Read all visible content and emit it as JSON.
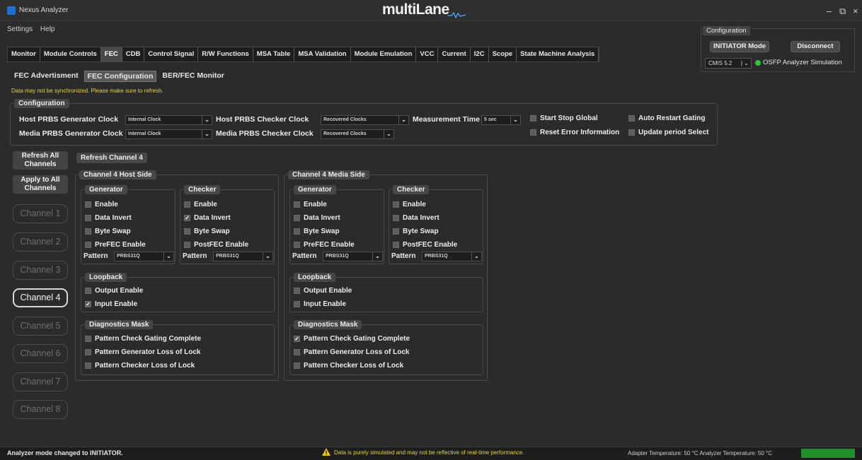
{
  "window": {
    "app_title": "Nexus Analyzer",
    "logo_text": "multiLane",
    "controls": [
      "–",
      "⧉",
      "×"
    ]
  },
  "menu": [
    "Settings",
    "Help"
  ],
  "main_tabs": [
    "Monitor",
    "Module Controls",
    "FEC",
    "CDB",
    "Control Signal",
    "R/W Functions",
    "MSA Table",
    "MSA Validation",
    "Module Emulation",
    "VCC",
    "Current",
    "I2C",
    "Scope",
    "State Machine Analysis"
  ],
  "main_tab_active": "FEC",
  "top_config": {
    "label": "Configuration",
    "mode_button": "INITIATOR Mode",
    "disconnect_button": "Disconnect",
    "cmis_value": "CMIS 5.2",
    "sim_label": "OSFP Analyzer Simulation",
    "led_color": "#27c93f"
  },
  "sub_tabs": [
    "FEC Advertisment",
    "FEC Configuration",
    "BER/FEC Monitor"
  ],
  "sub_tab_active": "FEC Configuration",
  "warning": "Data may not be synchronized. Please make sure to refresh.",
  "configuration": {
    "label": "Configuration",
    "host_gen_label": "Host PRBS Generator Clock",
    "host_gen_value": "Internal Clock",
    "media_gen_label": "Media PRBS Generator Clock",
    "media_gen_value": "Internal Clock",
    "host_chk_label": "Host PRBS Checker Clock",
    "host_chk_value": "Recovered Clocks",
    "media_chk_label": "Media PRBS Checker Clock",
    "media_chk_value": "Recovered Clocks",
    "meas_label": "Measurement Time",
    "meas_value": "5 sec",
    "start_stop": "Start Stop Global",
    "reset_error": "Reset Error Information",
    "auto_restart": "Auto Restart Gating",
    "update_period": "Update period Select"
  },
  "sidebar": {
    "refresh_all": "Refresh All Channels",
    "apply_all": "Apply to All Channels",
    "channels": [
      "Channel 1",
      "Channel 2",
      "Channel 3",
      "Channel 4",
      "Channel 5",
      "Channel 6",
      "Channel 7",
      "Channel 8"
    ],
    "active_channel": "Channel 4"
  },
  "refresh_channel": "Refresh Channel 4",
  "host_side": {
    "title": "Channel 4 Host Side",
    "generator": {
      "label": "Generator",
      "enable": "Enable",
      "data_invert": "Data Invert",
      "byte_swap": "Byte Swap",
      "fec_enable": "PreFEC Enable",
      "pattern_label": "Pattern",
      "pattern_value": "PRBS31Q"
    },
    "checker": {
      "label": "Checker",
      "enable": "Enable",
      "data_invert": "Data Invert",
      "byte_swap": "Byte Swap",
      "fec_enable": "PostFEC Enable",
      "pattern_label": "Pattern",
      "pattern_value": "PRBS31Q"
    },
    "loopback": {
      "label": "Loopback",
      "output": "Output Enable",
      "input": "Input Enable"
    },
    "diag": {
      "label": "Diagnostics Mask",
      "gating": "Pattern Check Gating Complete",
      "gen_lol": "Pattern Generator Loss of Lock",
      "chk_lol": "Pattern Checker Loss of Lock"
    }
  },
  "media_side": {
    "title": "Channel 4 Media Side",
    "generator": {
      "label": "Generator",
      "enable": "Enable",
      "data_invert": "Data Invert",
      "byte_swap": "Byte Swap",
      "fec_enable": "PreFEC Enable",
      "pattern_label": "Pattern",
      "pattern_value": "PRBS31Q"
    },
    "checker": {
      "label": "Checker",
      "enable": "Enable",
      "data_invert": "Data Invert",
      "byte_swap": "Byte Swap",
      "fec_enable": "PostFEC Enable",
      "pattern_label": "Pattern",
      "pattern_value": "PRBS31Q"
    },
    "loopback": {
      "label": "Loopback",
      "output": "Output Enable",
      "input": "Input Enable"
    },
    "diag": {
      "label": "Diagnostics Mask",
      "gating": "Pattern Check Gating Complete",
      "gen_lol": "Pattern Generator Loss of Lock",
      "chk_lol": "Pattern Checker Loss of Lock"
    }
  },
  "checked": {
    "host_checker_data_invert": true,
    "host_loopback_input": true,
    "media_diag_gating": true
  },
  "status": {
    "left": "Analyzer mode changed to INITIATOR.",
    "middle": "Data is purely simulated and may not be reflective of real-time performance.",
    "temps": "Adapter Temperature: 50 °C  Analyzer Temperature: 50 °C",
    "temp_bar_color": "#1f8f2a"
  }
}
